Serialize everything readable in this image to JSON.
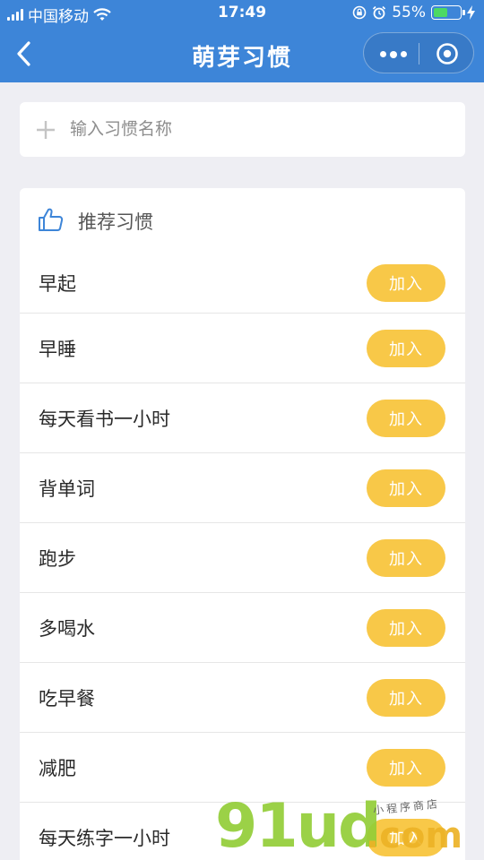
{
  "status_bar": {
    "carrier": "中国移动",
    "time": "17:49",
    "battery": "55%",
    "battery_level": 0.55
  },
  "nav": {
    "title": "萌芽习惯",
    "back_icon": "chevron-left-icon",
    "more_icon": "more-dots-icon",
    "close_icon": "target-icon"
  },
  "add_habit": {
    "placeholder": "输入习惯名称",
    "icon": "plus-icon"
  },
  "recommended": {
    "title": "推荐习惯",
    "icon": "thumbs-up-icon",
    "items": [
      {
        "label": "早起",
        "button": "加入"
      },
      {
        "label": "早睡",
        "button": "加入"
      },
      {
        "label": "每天看书一小时",
        "button": "加入"
      },
      {
        "label": "背单词",
        "button": "加入"
      },
      {
        "label": "跑步",
        "button": "加入"
      },
      {
        "label": "多喝水",
        "button": "加入"
      },
      {
        "label": "吃早餐",
        "button": "加入"
      },
      {
        "label": "减肥",
        "button": "加入"
      },
      {
        "label": "每天练字一小时",
        "button": "加入"
      }
    ]
  },
  "watermark": {
    "main": "91ud",
    "domain": ".com",
    "tagline": "小程序商店"
  },
  "colors": {
    "accent": "#3d85d8",
    "button": "#f8c848",
    "background": "#eeeef3"
  }
}
